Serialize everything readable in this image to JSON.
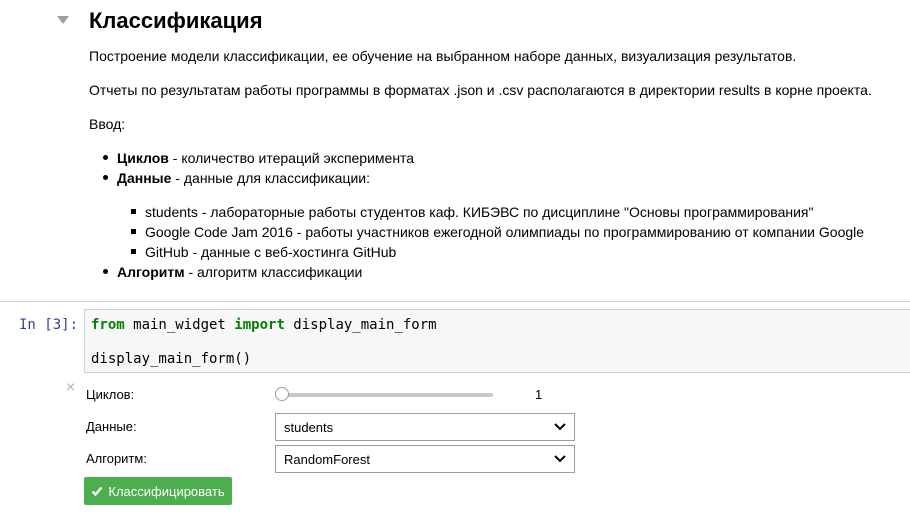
{
  "markdown": {
    "heading": "Классификация",
    "intro": "Построение модели классификации, ее обучение на выбранном наборе данных, визуализация результатов.",
    "reports": "Отчеты по результатам работы программы в форматах .json и .csv располагаются в директории results в корне проекта.",
    "input_label": "Ввод:",
    "params": [
      {
        "term": "Циклов",
        "desc": " - количество итераций эксперимента"
      },
      {
        "term": "Данные",
        "desc": " - данные для классификации:"
      },
      {
        "term": "Алгоритм",
        "desc": " - алгоритм классификации"
      }
    ],
    "datasets": [
      "students - лабораторные работы студентов каф. КИБЭВС по дисциплине \"Основы программирования\"",
      "Google Code Jam 2016 - работы участников ежегодной олимпиады по программированию от компании Google",
      "GitHub - данные с веб-хостинга GitHub"
    ]
  },
  "code_cell": {
    "prompt": "In [3]:",
    "line1": {
      "kw_from": "from",
      "module": " main_widget ",
      "kw_import": "import",
      "name": " display_main_form"
    },
    "line2": "display_main_form()"
  },
  "widget": {
    "cycles_label": "Циклов:",
    "cycles_value": "1",
    "slider_fraction": 0.0,
    "data_label": "Данные:",
    "data_selected": "students",
    "algo_label": "Алгоритм:",
    "algo_selected": "RandomForest",
    "button_label": "Классифицировать",
    "close_glyph": "×",
    "button_color": "#4cae4c"
  },
  "colors": {
    "prompt": "#303f9f",
    "keyword": "#008000",
    "code_bg": "#f7f7f7"
  },
  "icons": [
    "collapse-triangle-icon",
    "close-icon",
    "chevron-down-icon",
    "check-icon"
  ]
}
